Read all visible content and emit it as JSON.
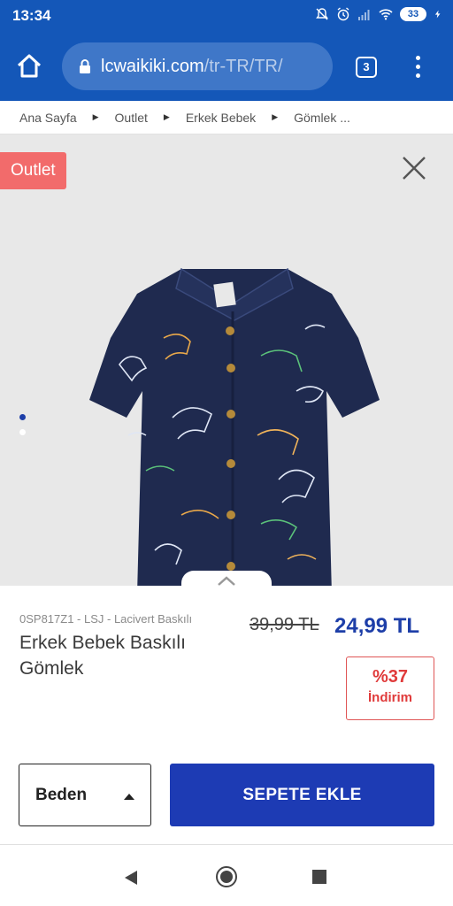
{
  "status_bar": {
    "time": "13:34",
    "battery": "33",
    "icons": [
      "mute-icon",
      "alarm-icon",
      "signal-icon",
      "wifi-icon",
      "battery-icon",
      "charging-icon"
    ]
  },
  "browser": {
    "url_domain": "lcwaikiki.com",
    "url_path": "/tr-TR/TR/",
    "tab_count": "3"
  },
  "breadcrumb": {
    "items": [
      "Ana Sayfa",
      "Outlet",
      "Erkek Bebek",
      "Gömlek ..."
    ]
  },
  "gallery": {
    "badge": "Outlet",
    "image_count": 2,
    "active_index": 0
  },
  "product": {
    "sku": "0SP817Z1 - LSJ - Lacivert Baskılı",
    "name": "Erkek Bebek Baskılı Gömlek",
    "old_price": "39,99 TL",
    "new_price": "24,99 TL",
    "discount_pct": "%37",
    "discount_label": "İndirim"
  },
  "actions": {
    "size_label": "Beden",
    "add_to_cart": "SEPETE EKLE"
  },
  "colors": {
    "brand_blue": "#1457b8",
    "cta_blue": "#1d3bb4",
    "price_blue": "#1d3ea8",
    "outlet_red": "#f26b6b",
    "discount_red": "#e03b3b",
    "shirt_navy": "#1f2a4f"
  }
}
